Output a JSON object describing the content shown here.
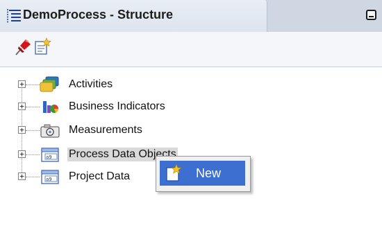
{
  "window": {
    "title": "DemoProcess - Structure"
  },
  "toolbar": {
    "buttons": [
      {
        "name": "pin",
        "icon": "pin-icon"
      },
      {
        "name": "new-note",
        "icon": "note-new-icon"
      }
    ]
  },
  "tree": {
    "items": [
      {
        "label": "Activities",
        "icon": "activities-icon",
        "expander": "+"
      },
      {
        "label": "Business Indicators",
        "icon": "business-indicators-icon",
        "expander": "+"
      },
      {
        "label": "Measurements",
        "icon": "camera-icon",
        "expander": "+"
      },
      {
        "label": "Process Data Objects",
        "icon": "data-object-icon",
        "expander": "+",
        "selected": true
      },
      {
        "label": "Project Data",
        "icon": "data-object-icon",
        "expander": "+"
      }
    ]
  },
  "context_menu": {
    "items": [
      {
        "label": "New",
        "icon": "new-icon",
        "highlighted": true
      }
    ]
  },
  "colors": {
    "highlight": "#3c6fd0",
    "selection": "#d9d9d9",
    "titlebar": "#dde4ee"
  }
}
